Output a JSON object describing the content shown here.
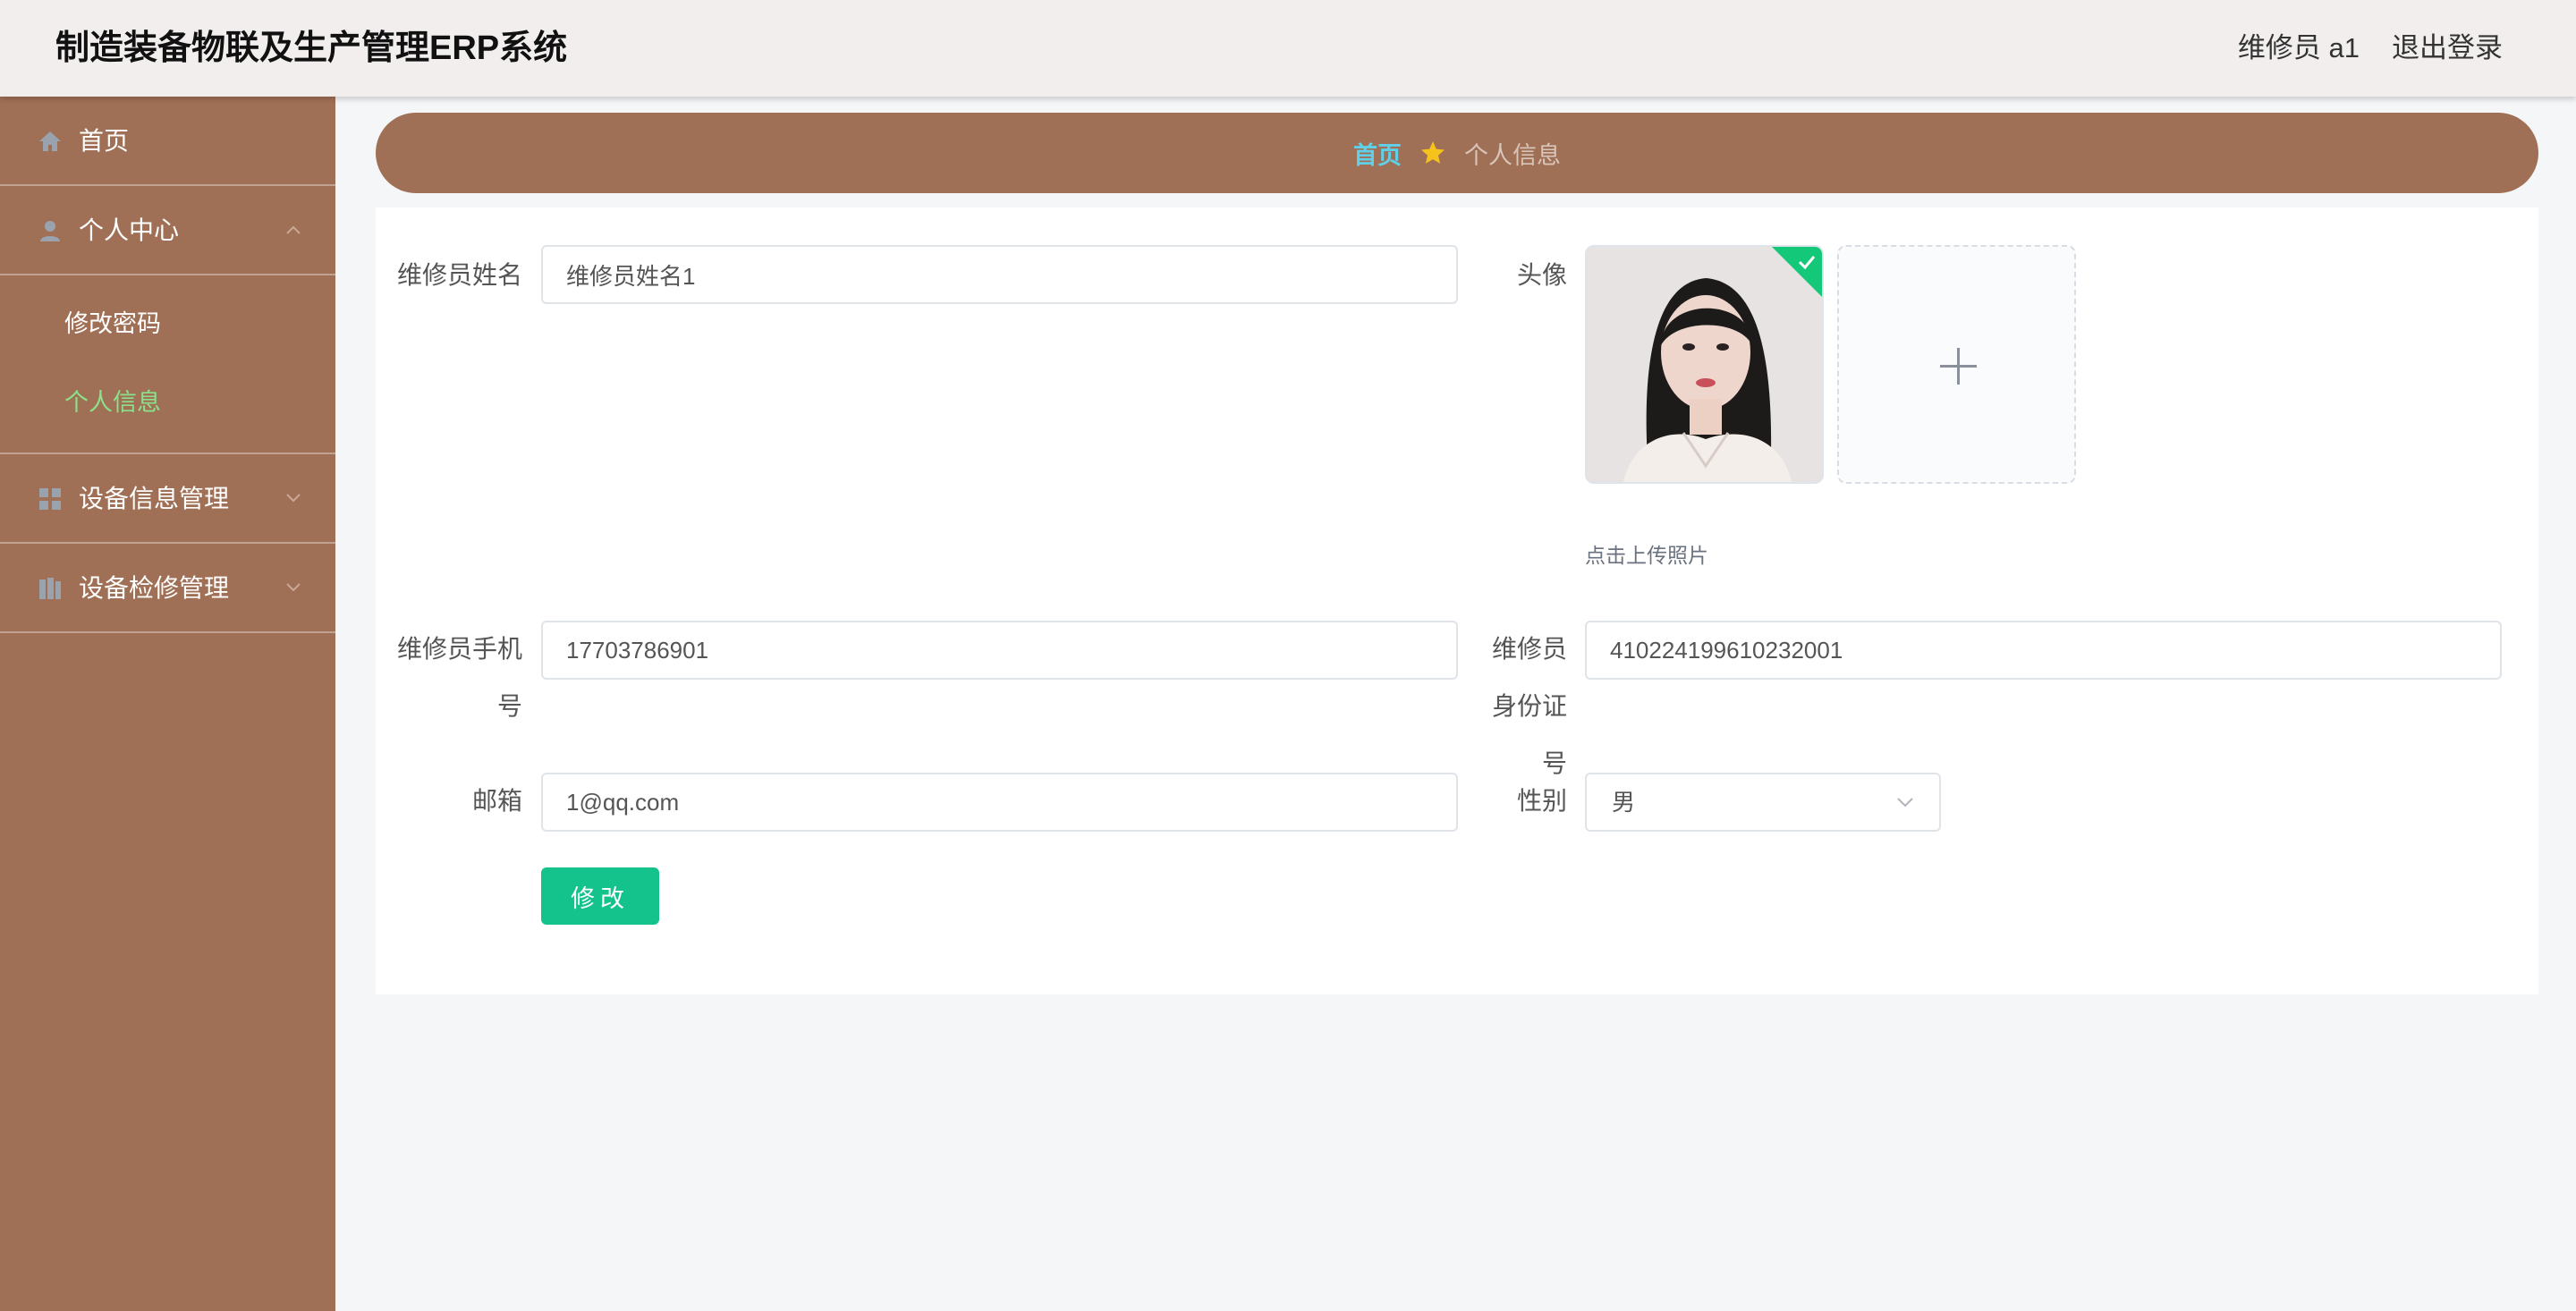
{
  "header": {
    "app_title": "制造装备物联及生产管理ERP系统",
    "user_label": "维修员 a1",
    "logout_label": "退出登录"
  },
  "sidebar": {
    "items": [
      {
        "label": "首页",
        "icon": "home-icon"
      },
      {
        "label": "个人中心",
        "icon": "user-icon",
        "expanded": true,
        "children": [
          {
            "label": "修改密码",
            "active": false
          },
          {
            "label": "个人信息",
            "active": true
          }
        ]
      },
      {
        "label": "设备信息管理",
        "icon": "grid-icon",
        "expanded": false
      },
      {
        "label": "设备检修管理",
        "icon": "book-icon",
        "expanded": false
      }
    ]
  },
  "breadcrumb": {
    "home": "首页",
    "separator_icon": "star-icon",
    "current": "个人信息"
  },
  "form": {
    "name": {
      "label": "维修员姓名",
      "value": "维修员姓名1"
    },
    "avatar": {
      "label": "头像",
      "upload_hint": "点击上传照片"
    },
    "phone": {
      "label": "维修员手机号",
      "value": "17703786901"
    },
    "id_card": {
      "label": "维修员身份证号",
      "value": "410224199610232001"
    },
    "email": {
      "label": "邮箱",
      "value": "1@qq.com"
    },
    "gender": {
      "label": "性别",
      "value": "男"
    },
    "submit_label": "修改"
  },
  "colors": {
    "sidebar_bg": "#a07056",
    "header_bg": "#f3eeee",
    "active_submenu": "#8be08b",
    "crumb_home": "#5fd0e8",
    "submit_button": "#14c28b"
  }
}
